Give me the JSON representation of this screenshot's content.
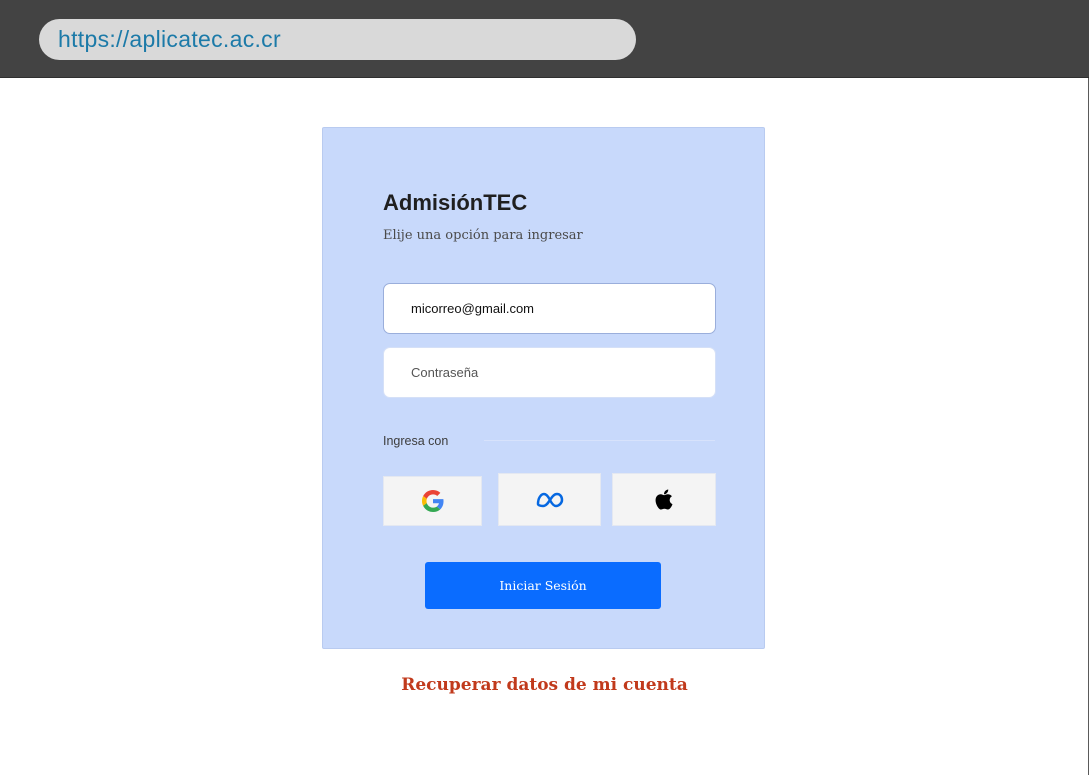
{
  "browser": {
    "url": "https://aplicatec.ac.cr"
  },
  "login": {
    "title": "AdmisiónTEC",
    "subtitle": "Elije una opción para ingresar",
    "email_value": "micorreo@gmail.com",
    "password_placeholder": "Contraseña",
    "social_label": "Ingresa con",
    "social_providers": [
      {
        "icon": "google-icon",
        "color": "#4285F4"
      },
      {
        "icon": "meta-icon",
        "color": "#0668E1"
      },
      {
        "icon": "apple-icon",
        "color": "#000000"
      }
    ],
    "submit_label": "Iniciar Sesión",
    "recover_label": "Recuperar datos de mi cuenta"
  },
  "colors": {
    "browser_bar": "#434343",
    "url_text": "#1c7aa8",
    "card_bg": "#c8d9fb",
    "primary_button": "#0a6cff",
    "recover_link": "#c13a1c"
  }
}
